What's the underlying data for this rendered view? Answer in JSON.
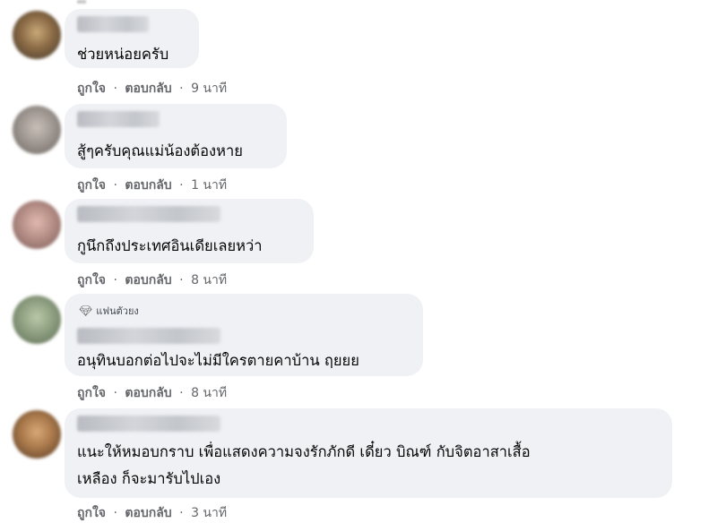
{
  "comments": [
    {
      "text": "ช่วยหน่อยครับ",
      "like": "ถูกใจ",
      "reply": "ตอบกลับ",
      "time": "9 นาที",
      "dot": "·"
    },
    {
      "text": "สู้ๆครับคุณแม่น้องต้องหาย",
      "like": "ถูกใจ",
      "reply": "ตอบกลับ",
      "time": "1 นาที",
      "dot": "·"
    },
    {
      "text": "กูนึกถึงประเทศอินเดียเลยหว่า",
      "like": "ถูกใจ",
      "reply": "ตอบกลับ",
      "time": "8 นาที",
      "dot": "·"
    },
    {
      "badge": "แฟนตัวยง",
      "badge_icon": "diamond-icon",
      "text": "อนุทินบอกต่อไปจะไม่มีใครตายคาบ้าน ฤยยย",
      "like": "ถูกใจ",
      "reply": "ตอบกลับ",
      "time": "8 นาที",
      "dot": "·"
    },
    {
      "text_line1": "แนะให้หมอบกราบ เพื่อแสดงความจงรักภักดี เดี๋ยว บิณฑ์ กับจิตอาสาเสื้อ",
      "text_line2": "เหลือง ก็จะมารับไปเอง",
      "like": "ถูกใจ",
      "reply": "ตอบกลับ",
      "time": "3 นาที",
      "dot": "·"
    }
  ],
  "colors": {
    "bubble": "#eff1f4",
    "meta_text": "#65676b",
    "comment_text": "#050505"
  }
}
